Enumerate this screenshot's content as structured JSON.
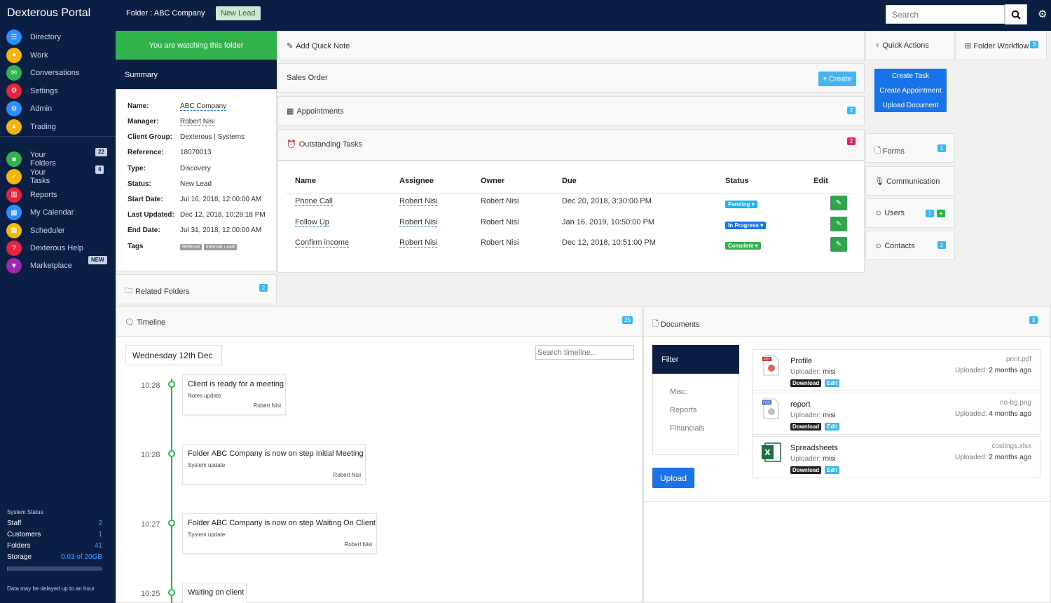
{
  "topbar": {
    "brand": "Dexterous Portal",
    "folder_title": "Folder : ABC Company",
    "status_badge": "New Lead",
    "search_placeholder": "Search"
  },
  "sidebar": {
    "main": [
      {
        "label": "Directory",
        "color": "#2a8cff"
      },
      {
        "label": "Work",
        "color": "#f5b50a"
      },
      {
        "label": "Conversations",
        "color": "#2fb34a"
      },
      {
        "label": "Settings",
        "color": "#e8243c"
      },
      {
        "label": "Admin",
        "color": "#2a8cff"
      },
      {
        "label": "Trading",
        "color": "#f5b50a"
      }
    ],
    "secondary": [
      {
        "label": "Your Folders",
        "badge": "22",
        "color": "#2fb34a"
      },
      {
        "label": "Your Tasks",
        "badge": "4",
        "color": "#f5b50a"
      },
      {
        "label": "Reports",
        "badge": "",
        "color": "#e8243c"
      },
      {
        "label": "My Calendar",
        "badge": "",
        "color": "#2a8cff"
      },
      {
        "label": "Scheduler",
        "badge": "",
        "color": "#f5b50a"
      },
      {
        "label": "Dexterous Help",
        "badge": "",
        "color": "#e8243c"
      },
      {
        "label": "Marketplace",
        "badge": "NEW",
        "color": "#9c27b0"
      }
    ],
    "system_status": {
      "label": "System Status",
      "rows": [
        {
          "k": "Staff",
          "v": "2"
        },
        {
          "k": "Customers",
          "v": "1"
        },
        {
          "k": "Folders",
          "v": "41"
        },
        {
          "k": "Storage",
          "v": "0.03 of 20GB"
        }
      ],
      "storage_fraction": 0.0015,
      "note": "Data may be delayed up to an hour"
    }
  },
  "watch_banner": "You are watching this folder",
  "summary": {
    "title": "Summary",
    "rows": [
      {
        "k": "Name:",
        "v": "ABC Company"
      },
      {
        "k": "Manager:",
        "v": "Robert Nisi"
      },
      {
        "k": "Client Group:",
        "v": "Dexterous | Systems"
      },
      {
        "k": "Reference:",
        "v": "18070013"
      },
      {
        "k": "Type:",
        "v": "Discovery"
      },
      {
        "k": "Status:",
        "v": "New Lead"
      },
      {
        "k": "Start Date:",
        "v": "Jul 16, 2018, 12:00:00 AM"
      },
      {
        "k": "Last Updated:",
        "v": "Dec 12, 2018, 10:28:18 PM"
      },
      {
        "k": "End Date:",
        "v": "Jul 31, 2018, 12:00:00 AM"
      }
    ],
    "tags_label": "Tags",
    "tags": [
      "Referral",
      "Internal Lead"
    ]
  },
  "related_folders": {
    "label": "Related Folders",
    "count": "2"
  },
  "quick_note": "Add Quick Note",
  "sales_order": {
    "label": "Sales Order",
    "create": "Create"
  },
  "appointments": {
    "label": "Appointments",
    "count": "2"
  },
  "tasks": {
    "label": "Outstanding Tasks",
    "count": "2",
    "columns": [
      "Name",
      "Assignee",
      "Owner",
      "Due",
      "Status",
      "Edit"
    ],
    "rows": [
      {
        "name": "Phone Call",
        "assignee": "Robert Nisi",
        "owner": "Robert Nisi",
        "due": "Dec 20, 2018, 3:30:00 PM",
        "status": "Pending",
        "status_color": "#1eb2f0"
      },
      {
        "name": "Follow Up",
        "assignee": "Robert Nisi",
        "owner": "Robert Nisi",
        "due": "Jan 16, 2019, 10:50:00 PM",
        "status": "In Progress",
        "status_color": "#1a73e8"
      },
      {
        "name": "Confirm income",
        "assignee": "Robert Nisi",
        "owner": "Robert Nisi",
        "due": "Dec 12, 2018, 10:51:00 PM",
        "status": "Complete",
        "status_color": "#2fb34a"
      }
    ]
  },
  "quick_actions": {
    "label": "Quick Actions",
    "items": [
      "Create Task",
      "Create Appointment",
      "Upload Document"
    ]
  },
  "folder_workflow": {
    "label": "Folder Workflow",
    "count": "3"
  },
  "right_panels": [
    {
      "label": "Forms",
      "count": "1"
    },
    {
      "label": "Communication",
      "count": ""
    },
    {
      "label": "Users",
      "count": "1"
    },
    {
      "label": "Contacts",
      "count": "1"
    }
  ],
  "timeline": {
    "label": "Timeline",
    "count": "25",
    "date": "Wednesday 12th Dec",
    "search_placeholder": "Search timeline...",
    "events": [
      {
        "time": "10:28",
        "title": "Client is ready for a meeting",
        "sub": "Notes update",
        "author": "Robert Nisi"
      },
      {
        "time": "10:28",
        "title": "Folder ABC Company is now on step Initial Meeting",
        "sub": "System update",
        "author": "Robert Nisi"
      },
      {
        "time": "10:27",
        "title": "Folder ABC Company is now on step Waiting On Client",
        "sub": "System update",
        "author": "Robert Nisi"
      },
      {
        "time": "10:25",
        "title": "Waiting on client",
        "sub": "",
        "author": ""
      }
    ]
  },
  "documents": {
    "label": "Documents",
    "count": "3",
    "filter_title": "Filter",
    "filters": [
      "Misc.",
      "Reports",
      "Financials"
    ],
    "upload": "Upload",
    "items": [
      {
        "name": "Profile",
        "uploader_label": "Uploader:",
        "uploader": "rnisi",
        "file": "print.pdf",
        "uploaded_label": "Uploaded:",
        "uploaded": "2 months ago",
        "icon": "pdf-icon",
        "icon_tag": "PDF"
      },
      {
        "name": "report",
        "uploader_label": "Uploader:",
        "uploader": "rnisi",
        "file": "no-bg.png",
        "uploaded_label": "Uploaded:",
        "uploaded": "4 months ago",
        "icon": "png-icon",
        "icon_tag": "PNG"
      },
      {
        "name": "Spreadsheets",
        "uploader_label": "Uploader:",
        "uploader": "rnisi",
        "file": "costings.xlsx",
        "uploaded_label": "Uploaded:",
        "uploaded": "2 months ago",
        "icon": "excel-icon",
        "icon_tag": "X"
      }
    ],
    "download_label": "Download",
    "edit_label": "Edit"
  }
}
